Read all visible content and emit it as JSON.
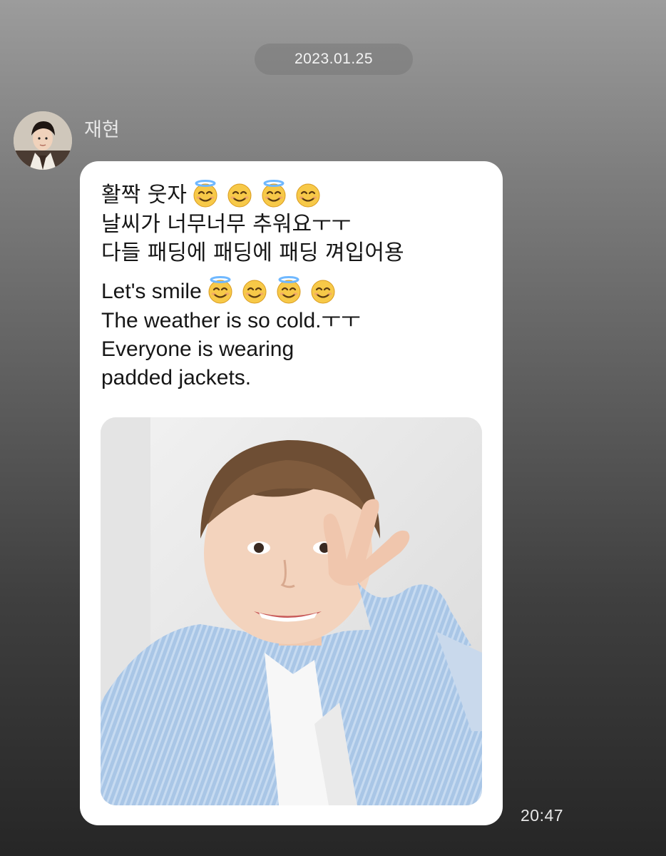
{
  "chat": {
    "date": "2023.01.25",
    "sender_name": "재현",
    "time": "20:47"
  },
  "message": {
    "korean_lines": [
      "활짝 웃자",
      "날씨가 너무너무 추워요ㅜㅜ",
      "다들 패딩에 패딩에 패딩 껴입어용"
    ],
    "english_lines": [
      "Let's smile",
      "The weather is so cold.ㅜㅜ",
      "Everyone is wearing",
      "padded jackets."
    ],
    "emoji_sequence": [
      "smiling-face-with-halo",
      "smiling-face-with-smiling-eyes",
      "smiling-face-with-halo",
      "smiling-face-with-smiling-eyes"
    ]
  },
  "colors": {
    "bubble": "#ffffff",
    "text": "#161616",
    "background_top": "#9c9c9c",
    "background_bottom": "#262626",
    "emoji_face": "#f7c948",
    "halo": "#6fb8ff"
  }
}
